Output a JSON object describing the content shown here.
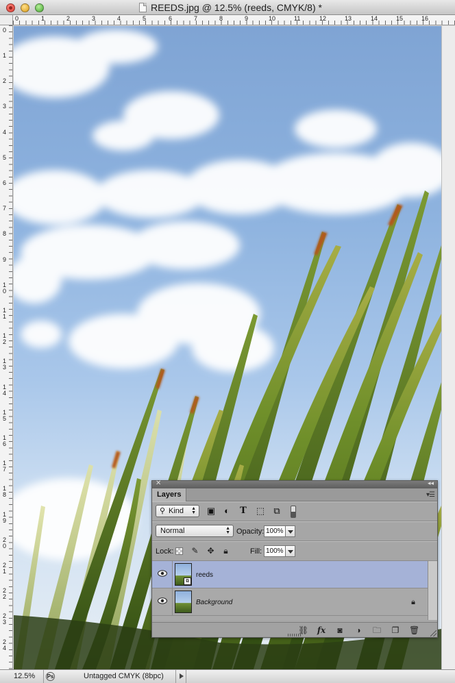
{
  "window": {
    "title": "REEDS.jpg @ 12.5% (reeds, CMYK/8) *"
  },
  "ruler": {
    "top_numbers": [
      "0",
      "1",
      "2",
      "3",
      "4",
      "5",
      "6",
      "7",
      "8",
      "9",
      "10",
      "11",
      "12",
      "13",
      "14",
      "15",
      "16"
    ],
    "left_numbers": [
      "0",
      "1",
      "2",
      "3",
      "4",
      "5",
      "6",
      "7",
      "8",
      "9",
      "1\n0",
      "1\n1",
      "1\n2",
      "1\n3",
      "1\n4",
      "1\n5",
      "1\n6",
      "1\n7",
      "1\n8",
      "1\n9",
      "2\n0",
      "2\n1",
      "2\n2",
      "2\n3",
      "2\n4"
    ]
  },
  "status_bar": {
    "zoom": "12.5%",
    "doc_profile": "Untagged CMYK (8bpc)"
  },
  "layers_panel": {
    "tab_label": "Layers",
    "filter_kind": "Kind",
    "blend_mode": "Normal",
    "opacity_label": "Opacity:",
    "opacity_value": "100%",
    "lock_label": "Lock:",
    "fill_label": "Fill:",
    "fill_value": "100%",
    "layers": [
      {
        "name": "reeds",
        "selected": true,
        "visible": true,
        "smart_object": true
      },
      {
        "name": "Background",
        "selected": false,
        "visible": true,
        "locked": true
      }
    ]
  },
  "colors": {
    "selected_layer": "#a5b2d7",
    "panel_bg": "#a6a6a6",
    "sky": "#8eb3df"
  }
}
